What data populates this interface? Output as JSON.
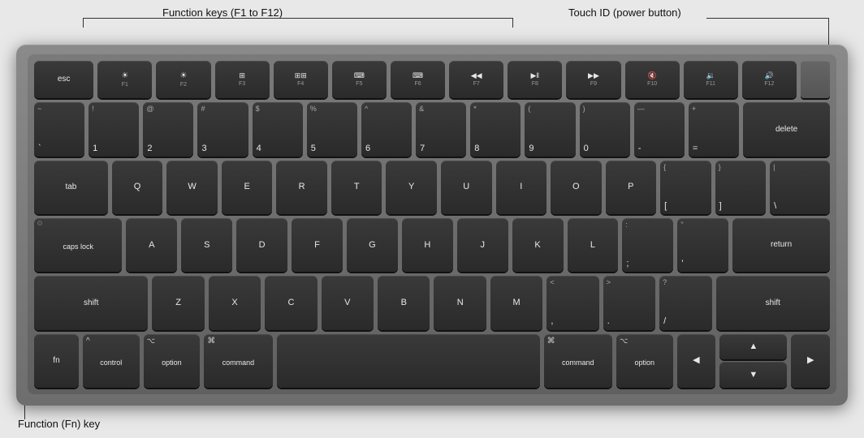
{
  "annotations": {
    "function_keys_label": "Function keys (F1 to F12)",
    "touchid_label": "Touch ID (power button)",
    "fn_key_label": "Function (Fn) key"
  },
  "keyboard": {
    "rows": {
      "fn_row": [
        "esc",
        "F1",
        "F2",
        "F3",
        "F4",
        "F5",
        "F6",
        "F7",
        "F8",
        "F9",
        "F10",
        "F11",
        "F12",
        "TouchID"
      ],
      "number_row": [
        "~`",
        "!1",
        "@2",
        "#3",
        "$4",
        "%5",
        "^6",
        "&7",
        "*8",
        "(9",
        ")0",
        "—-",
        "+=",
        "delete"
      ],
      "qwerty_row": [
        "tab",
        "Q",
        "W",
        "E",
        "R",
        "T",
        "Y",
        "U",
        "I",
        "O",
        "P",
        "{[",
        "}]",
        "|\\"
      ],
      "asdf_row": [
        "caps lock",
        "A",
        "S",
        "D",
        "F",
        "G",
        "H",
        "J",
        "K",
        "L",
        ";:",
        "'\"",
        "return"
      ],
      "zxcv_row": [
        "shift",
        "Z",
        "X",
        "C",
        "V",
        "B",
        "N",
        "M",
        "<,",
        ">.",
        "?/",
        "shift"
      ],
      "bottom_row": [
        "fn",
        "control",
        "option",
        "command",
        "space",
        "command",
        "option",
        "◀",
        "▲▼",
        "▶"
      ]
    }
  }
}
